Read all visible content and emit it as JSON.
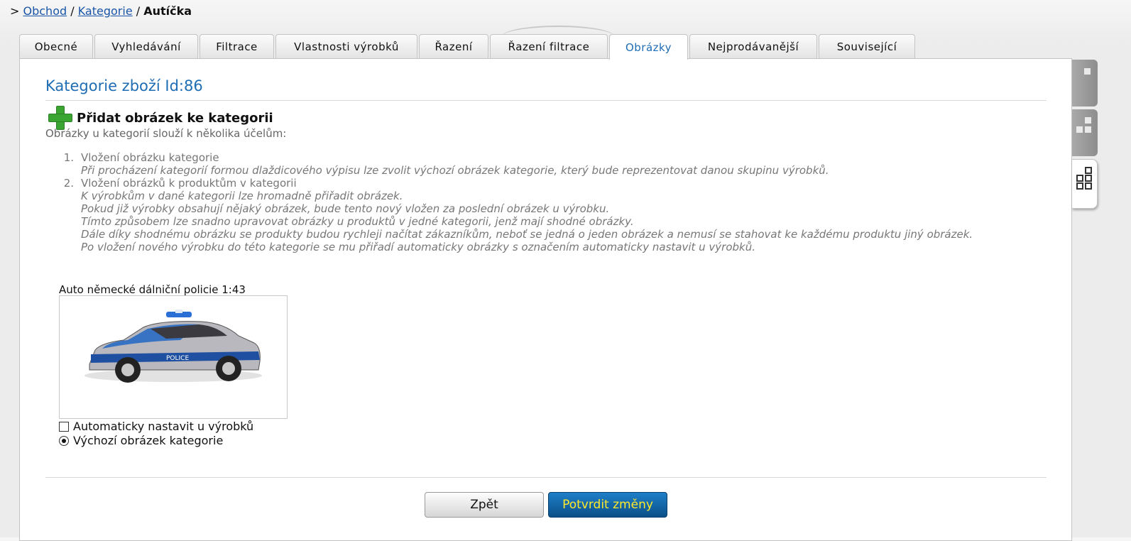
{
  "breadcrumb": {
    "prefix": ">",
    "items": [
      "Obchod",
      "Kategorie"
    ],
    "separator": "/",
    "current": "Autíčka"
  },
  "tabs": [
    "Obecné",
    "Vyhledávání",
    "Filtrace",
    "Vlastnosti výrobků",
    "Řazení",
    "Řazení filtrace",
    "Obrázky",
    "Nejprodávanější",
    "Související"
  ],
  "active_tab": "Obrázky",
  "main": {
    "title": "Kategorie zboží Id:86",
    "add_image_label": "Přidat obrázek ke kategorii",
    "intro": "Obrázky u kategorií slouží k několika účelům:",
    "list": [
      {
        "num": "1.",
        "title": "Vložení obrázku kategorie",
        "lines": [
          "Při procházení kategorií formou dlaždicového výpisu lze zvolit výchozí obrázek kategorie, který bude reprezentovat danou skupinu výrobků."
        ]
      },
      {
        "num": "2.",
        "title": "Vložení obrázků k produktům v kategorii",
        "lines": [
          "K výrobkům v dané kategorii lze hromadně přiřadit obrázek.",
          "Pokud již výrobky obsahují nějaký obrázek, bude tento nový vložen za poslední obrázek u výrobku.",
          "Tímto způsobem lze snadno upravovat obrázky u produktů v jedné kategorii, jenž mají shodné obrázky.",
          "Dále díky shodnému obrázku se produkty budou rychleji načítat zákazníkům, neboť se jedná o jeden obrázek a nemusí se stahovat ke každému produktu jiný obrázek.",
          "Po vložení nového výrobku do této kategorie se mu přiřadí automaticky obrázky s označením automaticky nastavit u výrobků."
        ]
      }
    ]
  },
  "image_card": {
    "title": "Auto německé dálniční policie 1:43",
    "car_label": "POLICE",
    "auto_assign_label": "Automaticky nastavit u výrobků",
    "auto_assign_checked": false,
    "default_image_label": "Výchozí obrázek kategorie",
    "default_image_selected": true
  },
  "buttons": {
    "back": "Zpět",
    "confirm": "Potvrdit změny"
  },
  "colors": {
    "accent": "#1f6db3",
    "confirm_bg": "#0d5c9c",
    "confirm_text": "#ffe92a",
    "link": "#1a55a8"
  },
  "side_view_icons": [
    "list-view-icon",
    "small-tiles-icon",
    "large-tiles-icon"
  ]
}
